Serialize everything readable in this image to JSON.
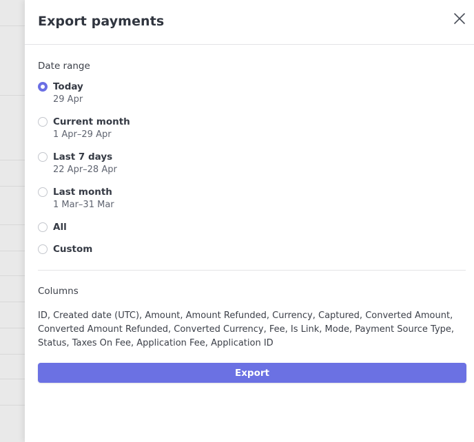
{
  "panel": {
    "title": "Export payments"
  },
  "date_range": {
    "label": "Date range",
    "options": [
      {
        "label": "Today",
        "sub": "29 Apr",
        "selected": true
      },
      {
        "label": "Current month",
        "sub": "1 Apr–29 Apr",
        "selected": false
      },
      {
        "label": "Last 7 days",
        "sub": "22 Apr–28 Apr",
        "selected": false
      },
      {
        "label": "Last month",
        "sub": "1 Mar–31 Mar",
        "selected": false
      },
      {
        "label": "All",
        "sub": "",
        "selected": false
      },
      {
        "label": "Custom",
        "sub": "",
        "selected": false
      }
    ]
  },
  "columns": {
    "label": "Columns",
    "text": "ID, Created date (UTC), Amount, Amount Refunded, Currency, Captured, Converted Amount, Converted Amount Refunded, Converted Currency, Fee, Is Link, Mode, Payment Source Type, Status, Taxes On Fee, Application Fee, Application ID"
  },
  "export_button": {
    "label": "Export"
  },
  "colors": {
    "accent": "#6b71e3",
    "radio_selected": "#6b6fe4"
  },
  "icons": {
    "close": "close-icon"
  }
}
